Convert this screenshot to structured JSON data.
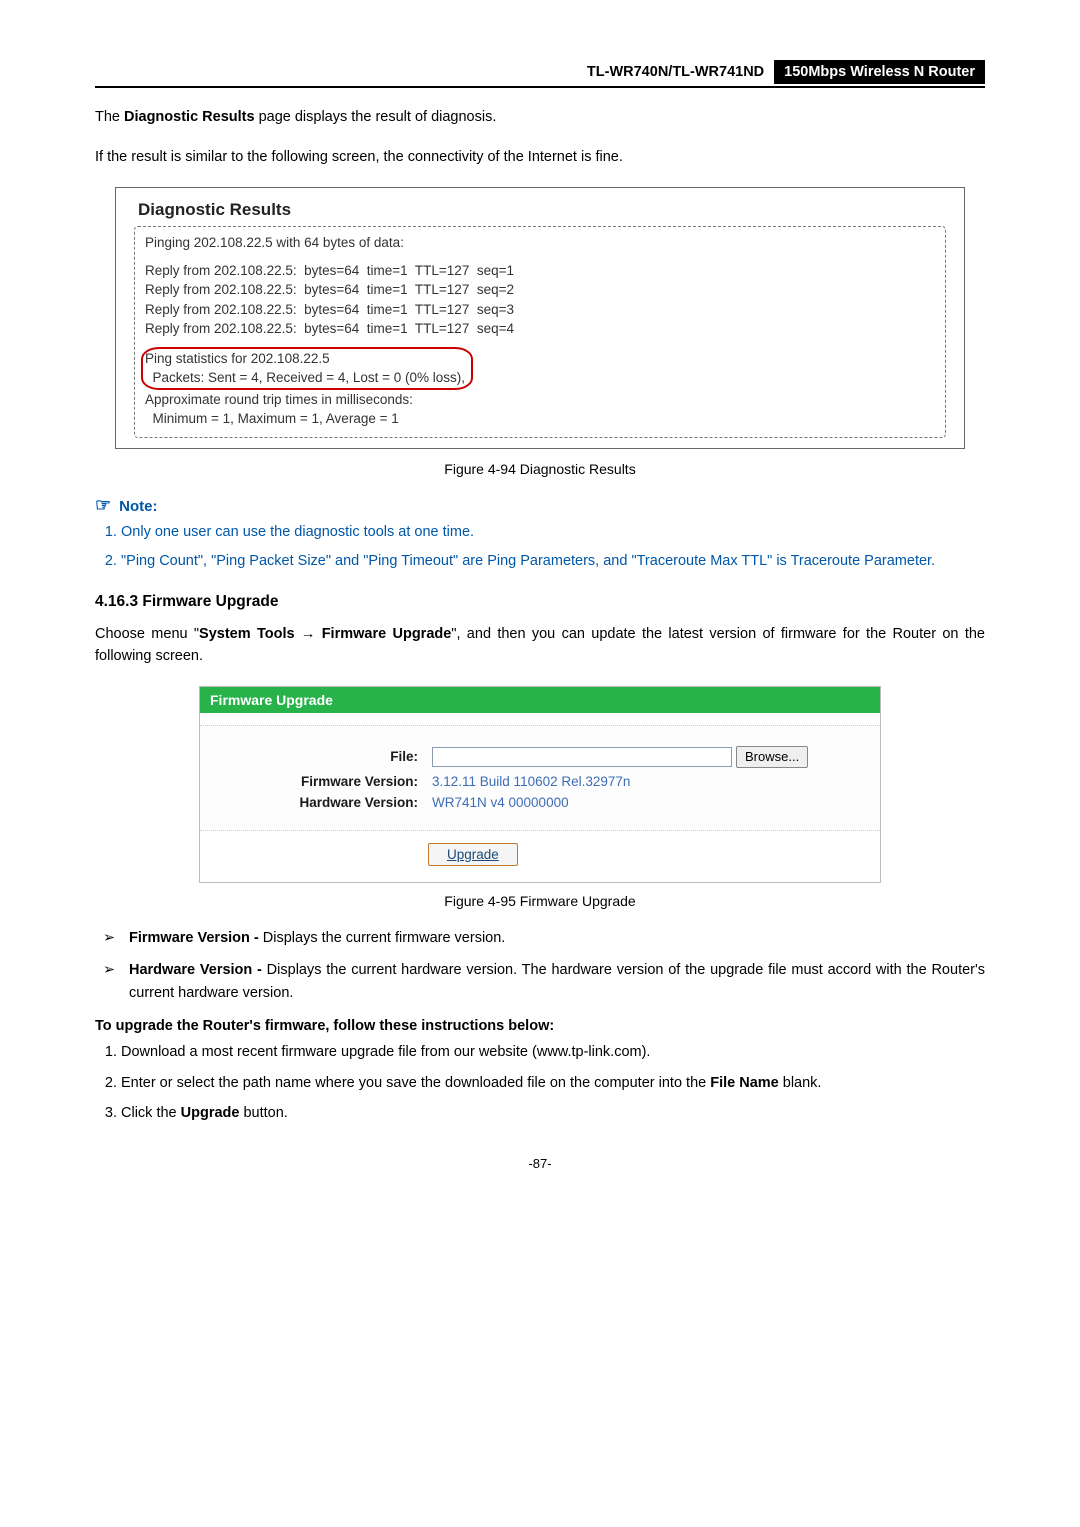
{
  "header": {
    "model": "TL-WR740N/TL-WR741ND",
    "product": "150Mbps Wireless N Router"
  },
  "intro1_pre": "The ",
  "intro1_bold": "Diagnostic Results",
  "intro1_post": " page displays the result of diagnosis.",
  "intro2": "If the result is similar to the following screen, the connectivity of the Internet is fine.",
  "diag": {
    "title": "Diagnostic Results",
    "ping_header": "Pinging 202.108.22.5 with 64 bytes of data:",
    "replies": [
      "Reply from 202.108.22.5:  bytes=64  time=1  TTL=127  seq=1",
      "Reply from 202.108.22.5:  bytes=64  time=1  TTL=127  seq=2",
      "Reply from 202.108.22.5:  bytes=64  time=1  TTL=127  seq=3",
      "Reply from 202.108.22.5:  bytes=64  time=1  TTL=127  seq=4"
    ],
    "stats_line1": "Ping statistics for 202.108.22.5",
    "stats_line2": "  Packets: Sent = 4, Received = 4, Lost = 0 (0% loss),",
    "stats_line3": "Approximate round trip times in milliseconds:",
    "stats_line4": "  Minimum = 1, Maximum = 1, Average = 1"
  },
  "fig1_caption": "Figure 4-94    Diagnostic Results",
  "note": {
    "label": "Note:",
    "items": [
      "Only one user can use the diagnostic tools at one time.",
      "\"Ping Count\", \"Ping Packet Size\" and \"Ping Timeout\" are Ping Parameters, and \"Traceroute Max TTL\" is Traceroute Parameter."
    ]
  },
  "section_head": "4.16.3  Firmware Upgrade",
  "fw_intro_pre": "Choose menu \"",
  "fw_intro_b1": "System Tools",
  "fw_intro_arrow": " → ",
  "fw_intro_b2": "Firmware Upgrade",
  "fw_intro_post": "\", and then you can update the latest version of firmware for the Router on the following screen.",
  "fw_panel": {
    "title": "Firmware Upgrade",
    "file_label": "File:",
    "browse_label": "Browse...",
    "fw_ver_label": "Firmware Version:",
    "fw_ver_value": "3.12.11 Build 110602 Rel.32977n",
    "hw_ver_label": "Hardware Version:",
    "hw_ver_value": "WR741N v4 00000000",
    "upgrade_label": "Upgrade"
  },
  "fig2_caption": "Figure 4-95    Firmware Upgrade",
  "bullets": {
    "fwver_b": "Firmware Version -",
    "fwver_t": " Displays the current firmware version.",
    "hwver_b": "Hardware Version -",
    "hwver_t": " Displays the current hardware version. The hardware version of the upgrade file must accord with the Router's current hardware version."
  },
  "instr_head": "To upgrade the Router's firmware, follow these instructions below:",
  "instr": {
    "i1": "Download a most recent firmware upgrade file from our website (www.tp-link.com).",
    "i2_pre": "Enter or select the path name where you save the downloaded file on the computer into the ",
    "i2_b": "File Name",
    "i2_post": " blank.",
    "i3_pre": "Click the ",
    "i3_b": "Upgrade",
    "i3_post": " button."
  },
  "page_num": "-87-"
}
